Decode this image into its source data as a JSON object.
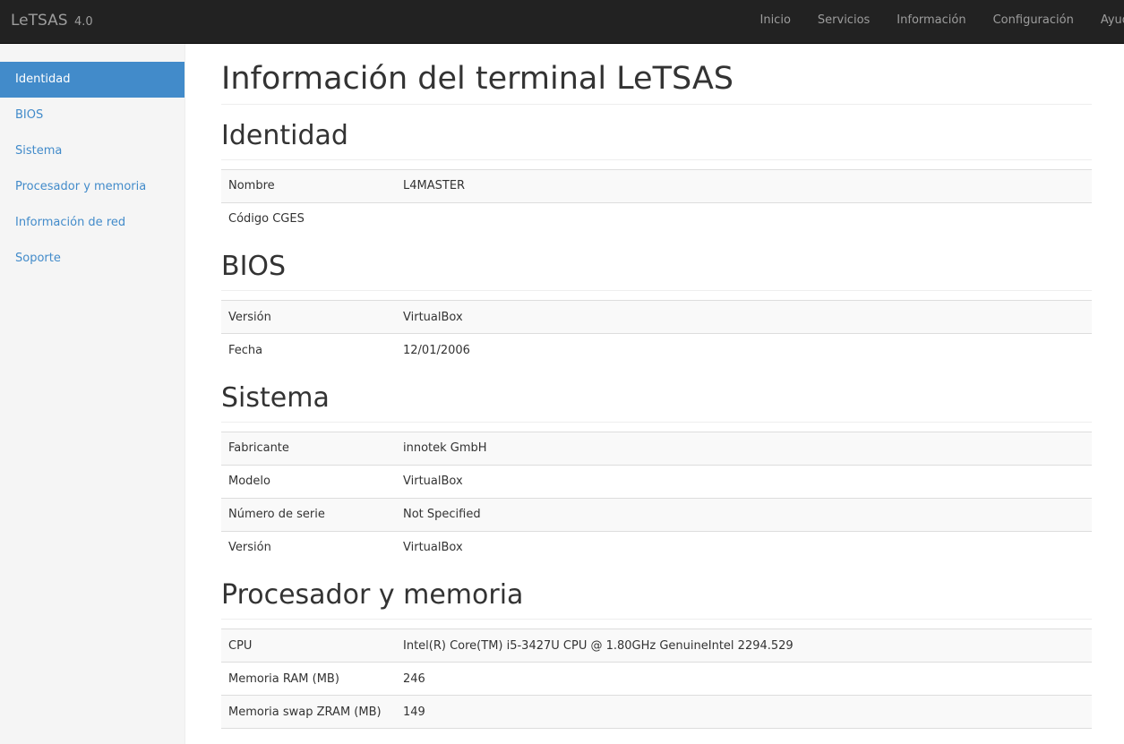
{
  "navbar": {
    "brand": "LeTSAS",
    "version": "4.0",
    "links": [
      "Inicio",
      "Servicios",
      "Información",
      "Configuración",
      "Ayuda"
    ]
  },
  "sidebar": {
    "items": [
      {
        "label": "Identidad",
        "active": true
      },
      {
        "label": "BIOS",
        "active": false
      },
      {
        "label": "Sistema",
        "active": false
      },
      {
        "label": "Procesador y memoria",
        "active": false
      },
      {
        "label": "Información de red",
        "active": false
      },
      {
        "label": "Soporte",
        "active": false
      }
    ]
  },
  "colors": {
    "navbar_bg": "#222222",
    "accent": "#428bca",
    "sidebar_bg": "#f5f5f5"
  },
  "page": {
    "title": "Información del terminal LeTSAS"
  },
  "sections": [
    {
      "title": "Identidad",
      "rows": [
        {
          "key": "Nombre",
          "value": "L4MASTER"
        },
        {
          "key": "Código CGES",
          "value": ""
        }
      ]
    },
    {
      "title": "BIOS",
      "rows": [
        {
          "key": "Versión",
          "value": "VirtualBox"
        },
        {
          "key": "Fecha",
          "value": "12/01/2006"
        }
      ]
    },
    {
      "title": "Sistema",
      "rows": [
        {
          "key": "Fabricante",
          "value": "innotek GmbH"
        },
        {
          "key": "Modelo",
          "value": "VirtualBox"
        },
        {
          "key": "Número de serie",
          "value": "Not Specified"
        },
        {
          "key": "Versión",
          "value": "VirtualBox"
        }
      ]
    },
    {
      "title": "Procesador y memoria",
      "rows": [
        {
          "key": "CPU",
          "value": "Intel(R) Core(TM) i5-3427U CPU @ 1.80GHz GenuineIntel 2294.529"
        },
        {
          "key": "Memoria RAM (MB)",
          "value": "246"
        },
        {
          "key": "Memoria swap ZRAM (MB)",
          "value": "149"
        }
      ]
    }
  ]
}
